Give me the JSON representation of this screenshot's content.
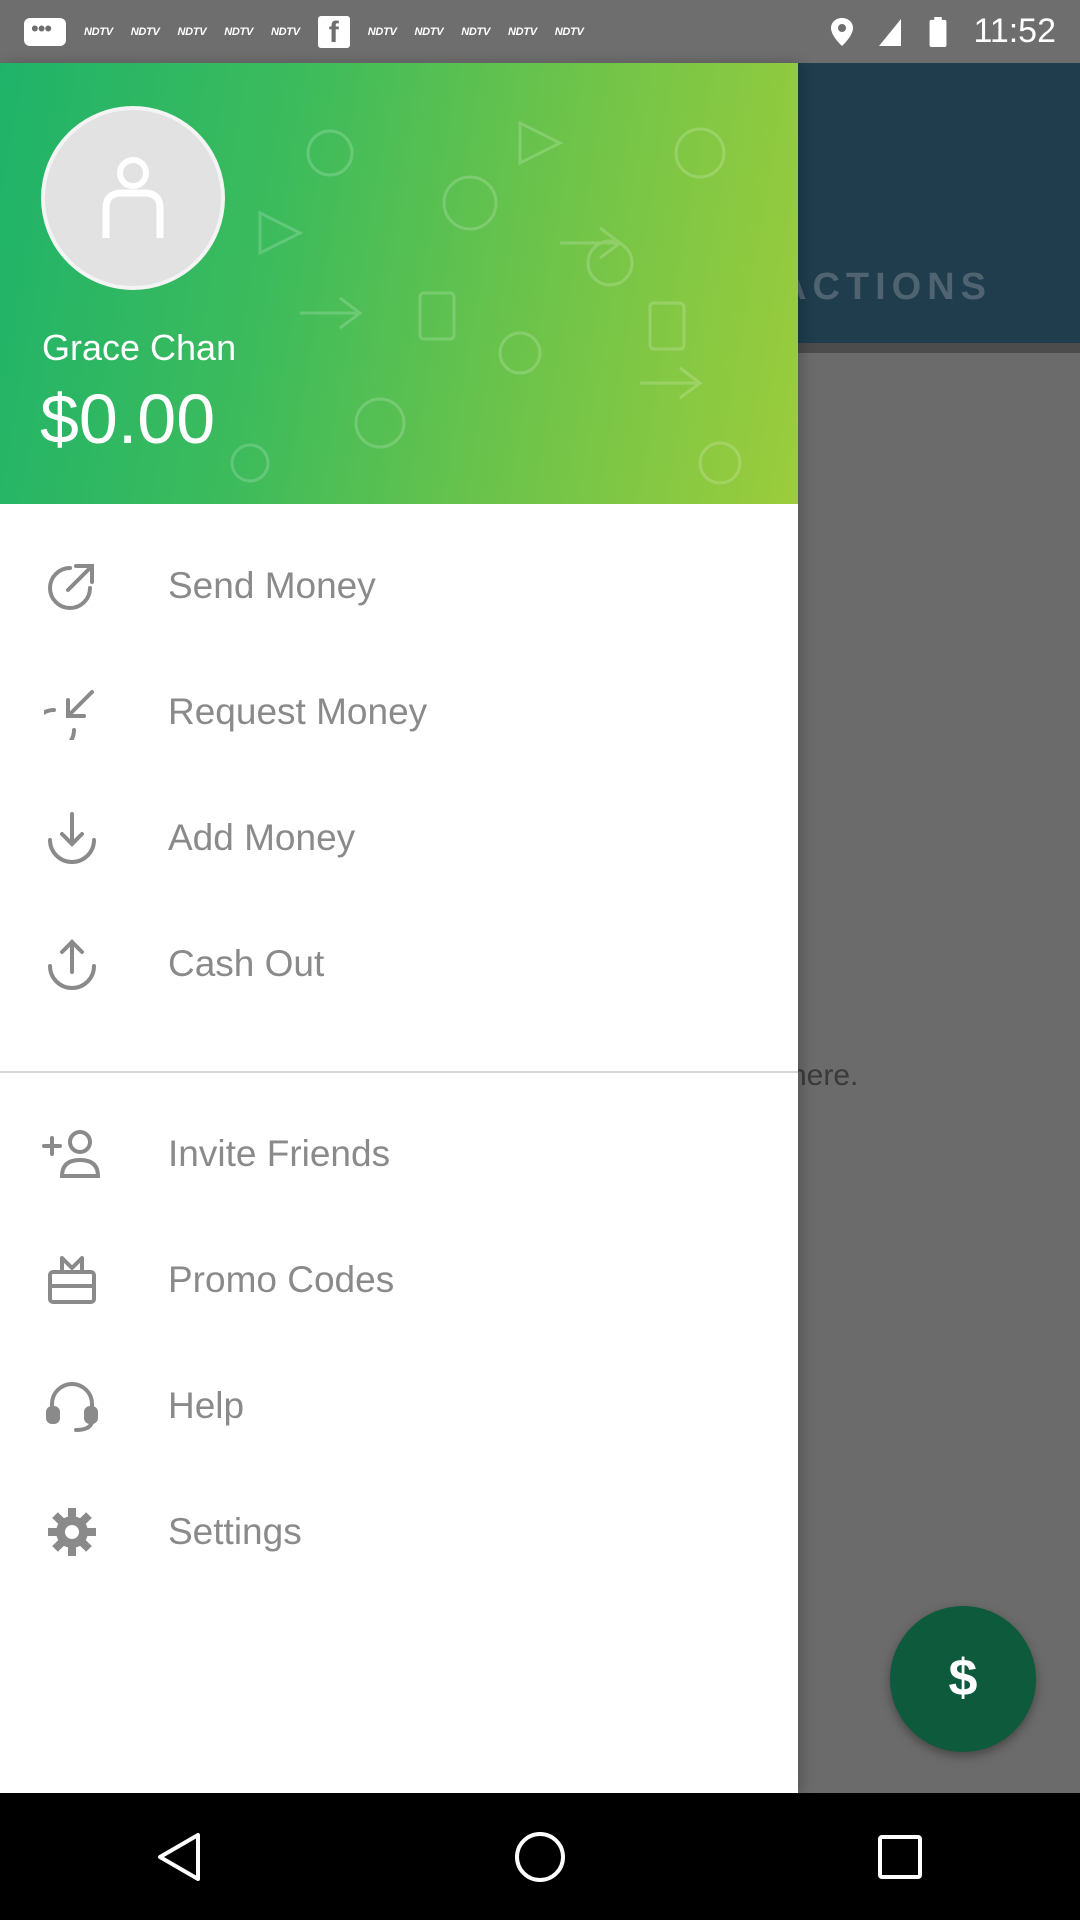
{
  "status_bar": {
    "notification_labels": [
      "NDTV",
      "NDTV",
      "NDTV",
      "NDTV",
      "NDTV",
      "NDTV",
      "NDTV",
      "NDTV",
      "NDTV",
      "NDTV"
    ],
    "time": "11:52"
  },
  "background_app": {
    "tab_label": "ACTIONS",
    "empty_text": "here."
  },
  "drawer": {
    "user_name": "Grace Chan",
    "balance": "$0.00",
    "menu_primary": [
      {
        "label": "Send Money",
        "icon": "send-arrow-icon"
      },
      {
        "label": "Request Money",
        "icon": "request-arrow-icon"
      },
      {
        "label": "Add Money",
        "icon": "download-icon"
      },
      {
        "label": "Cash Out",
        "icon": "upload-icon"
      }
    ],
    "menu_secondary": [
      {
        "label": "Invite Friends",
        "icon": "add-person-icon"
      },
      {
        "label": "Promo Codes",
        "icon": "gift-icon"
      },
      {
        "label": "Help",
        "icon": "headset-icon"
      },
      {
        "label": "Settings",
        "icon": "gear-icon"
      }
    ]
  },
  "colors": {
    "header_gradient_start": "#1fb36a",
    "header_gradient_end": "#9ccc3c",
    "fab": "#0d5a3c",
    "menu_text": "#8a8a8a"
  }
}
